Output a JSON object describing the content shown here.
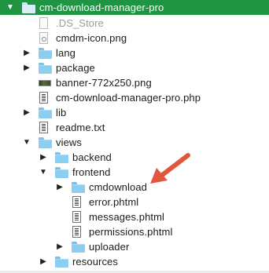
{
  "tree": {
    "root": {
      "name": "cm-download-manager-pro",
      "expanded": true
    },
    "files_level1": {
      "ds_store": ".DS_Store",
      "cmdm_icon": "cmdm-icon.png",
      "lang": "lang",
      "package": "package",
      "banner": "banner-772x250.png",
      "main_php": "cm-download-manager-pro.php",
      "lib": "lib",
      "readme": "readme.txt",
      "views": "views"
    },
    "views_children": {
      "backend": "backend",
      "frontend": "frontend",
      "resources": "resources"
    },
    "frontend_children": {
      "cmdownload": "cmdownload",
      "error": "error.phtml",
      "messages": "messages.phtml",
      "permissions": "permissions.phtml",
      "uploader": "uploader"
    },
    "disclosure": {
      "expanded": "▼",
      "collapsed": "▶"
    }
  },
  "colors": {
    "selection": "#1f9442",
    "folder": "#8ccdf2",
    "annotation_arrow": "#e2563f"
  },
  "annotation": {
    "type": "arrow",
    "points_to": "cmdownload"
  }
}
